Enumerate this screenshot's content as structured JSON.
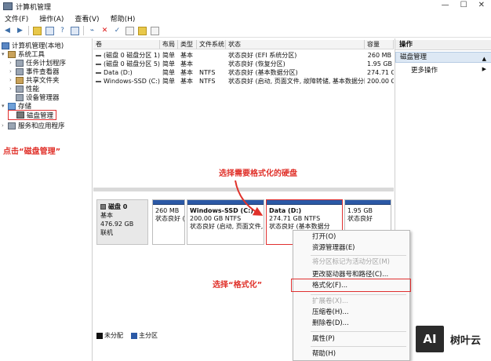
{
  "window": {
    "title": "计算机管理"
  },
  "menu": [
    "文件(F)",
    "操作(A)",
    "查看(V)",
    "帮助(H)"
  ],
  "tree": {
    "root": "计算机管理(本地)",
    "system_tools": "系统工具",
    "task_scheduler": "任务计划程序",
    "event_viewer": "事件查看器",
    "shared_folders": "共享文件夹",
    "performance": "性能",
    "device_manager": "设备管理器",
    "storage": "存储",
    "disk_management": "磁盘管理",
    "services": "服务和应用程序"
  },
  "volume_table": {
    "headers": [
      "卷",
      "布局",
      "类型",
      "文件系统",
      "状态",
      "容量"
    ],
    "rows": [
      {
        "volume": "(磁盘 0 磁盘分区 1)",
        "layout": "简单",
        "type": "基本",
        "fs": "",
        "status": "状态良好 (EFI 系统分区)",
        "capacity": "260 MB"
      },
      {
        "volume": "(磁盘 0 磁盘分区 5)",
        "layout": "简单",
        "type": "基本",
        "fs": "",
        "status": "状态良好 (恢复分区)",
        "capacity": "1.95 GB"
      },
      {
        "volume": "Data (D:)",
        "layout": "简单",
        "type": "基本",
        "fs": "NTFS",
        "status": "状态良好 (基本数据分区)",
        "capacity": "274.71 GB"
      },
      {
        "volume": "Windows-SSD (C:)",
        "layout": "简单",
        "type": "基本",
        "fs": "NTFS",
        "status": "状态良好 (启动, 页面文件, 故障转储, 基本数据分区)",
        "capacity": "200.00 GB"
      }
    ]
  },
  "disk": {
    "name": "磁盘 0",
    "kind": "基本",
    "size": "476.92 GB",
    "state": "联机",
    "partitions": [
      {
        "name": "",
        "size": "260 MB",
        "status": "状态良好 (E"
      },
      {
        "name": "Windows-SSD  (C:)",
        "size": "200.00 GB NTFS",
        "status": "状态良好 (启动, 页面文件,"
      },
      {
        "name": "Data  (D:)",
        "size": "274.71 GB NTFS",
        "status": "状态良好 (基本数据分"
      },
      {
        "name": "",
        "size": "1.95 GB",
        "status": "状态良好"
      }
    ]
  },
  "legend": {
    "unallocated": "未分配",
    "primary": "主分区"
  },
  "actions": {
    "header": "操作",
    "selected": "磁盘管理",
    "more": "更多操作"
  },
  "context_menu": {
    "open": "打开(O)",
    "explorer": "资源管理器(E)",
    "mark_active": "将分区标记为活动分区(M)",
    "change_letter": "更改驱动器号和路径(C)...",
    "format": "格式化(F)...",
    "extend": "扩展卷(X)...",
    "shrink": "压缩卷(H)...",
    "delete": "删除卷(D)...",
    "properties": "属性(P)",
    "help": "帮助(H)"
  },
  "annotations": {
    "click_disk_mgmt": "点击“磁盘管理”",
    "choose_disk": "选择需要格式化的硬盘",
    "choose_format": "选择“格式化”"
  },
  "watermark": {
    "logo": "AI",
    "text": "树叶云"
  },
  "colors": {
    "annotation": "#e0312a",
    "partition_bar": "#2b59a6",
    "selected_bg": "#dde8f4"
  }
}
